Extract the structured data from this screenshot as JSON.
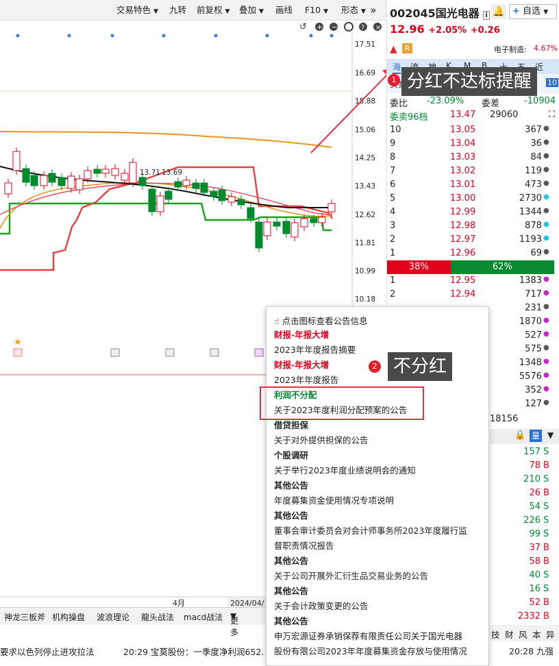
{
  "toolbar": {
    "items": [
      "交易特色",
      "九转",
      "前复权",
      "叠加",
      "画线",
      "F10",
      "形态"
    ],
    "expand": "»"
  },
  "chart": {
    "y_ticks": [
      "17.51",
      "16.69",
      "15.88",
      "15.06",
      "14.25",
      "13.43",
      "12.62",
      "11.81",
      "10.99",
      "10.18"
    ],
    "labels": {
      "peak1": "13.71",
      "peak2": "13.69"
    },
    "x_labels": {
      "month": "4月",
      "date": "2024/04/"
    },
    "colors": {
      "ma_black": "#111111",
      "ma_orange": "#e8941a",
      "band_red": "#e84040",
      "band_green": "#1aa31a",
      "up": "#e0001b",
      "down": "#008a2e"
    }
  },
  "bottom_tabs": [
    "神龙三板斧",
    "机构操盘",
    "波浪理论",
    "龍头战法",
    "macd战法",
    "更多"
  ],
  "ticker": {
    "left": "要求以色列停止进攻拉法",
    "right": "20:29 宝莫股份：一季度净利润652.",
    "right2": "20:28 九强"
  },
  "stock": {
    "code": "002045",
    "name": "国光电器",
    "price": "12.96",
    "pct": "+2.05%",
    "chg": "+0.26",
    "add_label": "自选",
    "industry_label": "电子制造:",
    "industry_pct": "4.67%",
    "badge_r": "R",
    "tabs": [
      "海",
      "流",
      "神",
      "K",
      "M",
      "B",
      "十",
      "五",
      "近"
    ],
    "bid_ratio_label": "委比",
    "bid_ratio": "-23.09%",
    "bid_diff_label": "委差",
    "bid_diff": "-10904",
    "sell96_label": "委卖96档",
    "sell96_price": "13.47",
    "sell96_vol": "29060",
    "buy_level_hint": "10",
    "buy_hint_label": "买卖"
  },
  "sell_levels": [
    {
      "lvl": "10",
      "price": "13.05",
      "vol": "367",
      "dot": "gray"
    },
    {
      "lvl": "9",
      "price": "13.04",
      "vol": "36",
      "dot": "gray"
    },
    {
      "lvl": "8",
      "price": "13.03",
      "vol": "84",
      "dot": "gray"
    },
    {
      "lvl": "7",
      "price": "13.02",
      "vol": "119",
      "dot": "gray"
    },
    {
      "lvl": "6",
      "price": "13.01",
      "vol": "473",
      "dot": "gray"
    },
    {
      "lvl": "5",
      "price": "13.00",
      "vol": "2730",
      "dot": "cyan"
    },
    {
      "lvl": "4",
      "price": "12.99",
      "vol": "1344",
      "dot": "gray"
    },
    {
      "lvl": "3",
      "price": "12.98",
      "vol": "878",
      "dot": "cyan"
    },
    {
      "lvl": "2",
      "price": "12.97",
      "vol": "1193",
      "dot": "cyan"
    },
    {
      "lvl": "1",
      "price": "12.96",
      "vol": "69",
      "dot": "gray"
    }
  ],
  "ratio": {
    "sell": "38%",
    "buy": "62%",
    "sell_fraction": 0.38
  },
  "buy_levels": [
    {
      "lvl": "1",
      "price": "12.95",
      "vol": "1383",
      "dot": "magenta"
    },
    {
      "lvl": "2",
      "price": "12.94",
      "vol": "717",
      "dot": "magenta"
    },
    {
      "lvl": "",
      "price": "",
      "vol": "231",
      "dot": "gray"
    },
    {
      "lvl": "",
      "price": "",
      "vol": "1870",
      "dot": "magenta"
    },
    {
      "lvl": "",
      "price": "",
      "vol": "527",
      "dot": "magenta"
    },
    {
      "lvl": "",
      "price": "",
      "vol": "575",
      "dot": "gray"
    },
    {
      "lvl": "",
      "price": "",
      "vol": "1348",
      "dot": "magenta"
    },
    {
      "lvl": "",
      "price": "",
      "vol": "5576",
      "dot": "magenta"
    },
    {
      "lvl": "",
      "price": "",
      "vol": "352",
      "dot": "magenta"
    },
    {
      "lvl": "",
      "price": "",
      "vol": "127",
      "dot": "gray"
    }
  ],
  "buy_total": "18156",
  "trades": [
    {
      "vol": "157",
      "side": "S"
    },
    {
      "vol": "78",
      "side": "B"
    },
    {
      "vol": "210",
      "side": "S"
    },
    {
      "vol": "26",
      "side": "B"
    },
    {
      "vol": "54",
      "side": "S"
    },
    {
      "vol": "226",
      "side": "S"
    },
    {
      "vol": "99",
      "side": "S"
    },
    {
      "vol": "37",
      "side": "B"
    },
    {
      "vol": "58",
      "side": "B"
    },
    {
      "vol": "40",
      "side": "S"
    },
    {
      "vol": "16",
      "side": "S"
    },
    {
      "vol": "52",
      "side": "B"
    },
    {
      "vol": "2332",
      "side": "B"
    }
  ],
  "right_bottom_tabs": [
    "技",
    "财",
    "风",
    "本",
    "异"
  ],
  "right_time": "20:28 九强",
  "popup": {
    "hint": "点击图标查看公告信息",
    "entries": [
      {
        "cat": "财报-年报大增",
        "title": "2023年年度报告摘要",
        "color": "red"
      },
      {
        "cat": "财报-年报大增",
        "title": "2023年年度报告",
        "color": "red"
      },
      {
        "cat": "利润不分配",
        "title": "关于2023年度利润分配预案的公告",
        "color": "green"
      },
      {
        "cat": "借贷担保",
        "title": "关于对外提供担保的公告",
        "color": "black"
      },
      {
        "cat": "个股调研",
        "title": "关于举行2023年度业绩说明会的通知",
        "color": "black"
      },
      {
        "cat": "其他公告",
        "title": "年度募集资金使用情况专项说明",
        "color": "black"
      },
      {
        "cat": "其他公告",
        "title": "董事会审计委员会对会计师事务所2023年度履行监",
        "title2": "督职责情况报告",
        "color": "black"
      },
      {
        "cat": "其他公告",
        "title": "关于公司开展外汇衍生品交易业务的公告",
        "color": "black"
      },
      {
        "cat": "其他公告",
        "title": "关于会计政策变更的公告",
        "color": "black"
      },
      {
        "cat": "其他公告",
        "title": "申万宏源证券承销保荐有限责任公司关于国光电器",
        "title2": "股份有限公司2023年年度募集资金存放与使用情况",
        "color": "black"
      }
    ]
  },
  "callouts": {
    "one": "分红不达标提醒",
    "two": "不分红"
  },
  "badges": {
    "one": "1",
    "two": "2"
  }
}
